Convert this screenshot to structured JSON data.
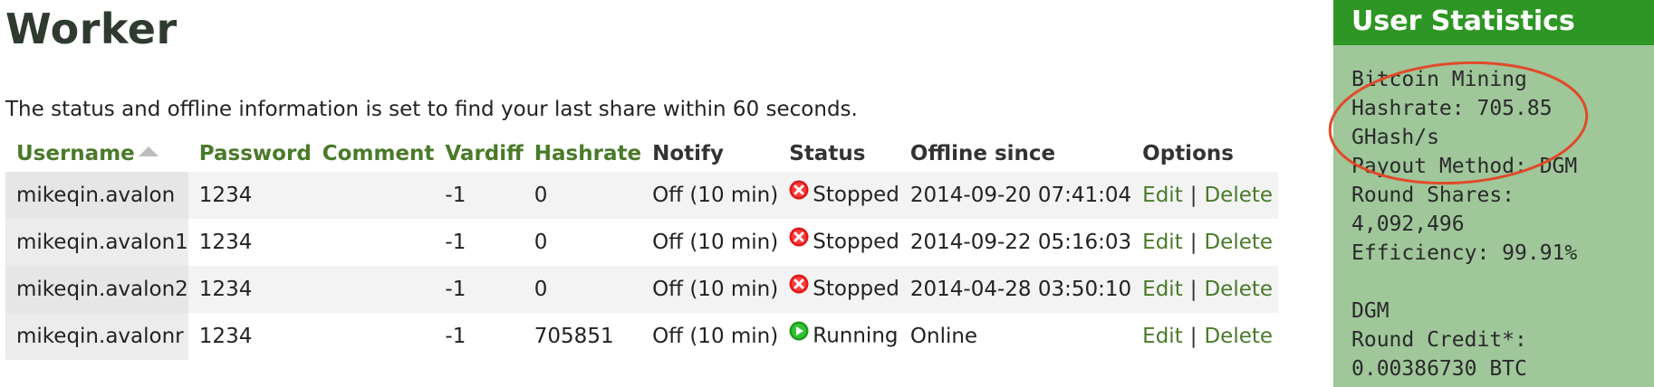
{
  "page": {
    "title": "Worker",
    "info": "The status and offline information is set to find your last share within 60 seconds."
  },
  "table": {
    "headers": {
      "username": "Username",
      "password": "Password",
      "comment": "Comment",
      "vardiff": "Vardiff",
      "hashrate": "Hashrate",
      "notify": "Notify",
      "status": "Status",
      "offline": "Offline since",
      "options": "Options"
    },
    "rows": [
      {
        "username": "mikeqin.avalon",
        "password": "1234",
        "comment": "",
        "vardiff": "-1",
        "hashrate": "0",
        "notify": "Off (10 min)",
        "status": "Stopped",
        "offline": "2014-09-20 07:41:04",
        "edit": "Edit",
        "delete": "Delete"
      },
      {
        "username": "mikeqin.avalon1",
        "password": "1234",
        "comment": "",
        "vardiff": "-1",
        "hashrate": "0",
        "notify": "Off (10 min)",
        "status": "Stopped",
        "offline": "2014-09-22 05:16:03",
        "edit": "Edit",
        "delete": "Delete"
      },
      {
        "username": "mikeqin.avalon2",
        "password": "1234",
        "comment": "",
        "vardiff": "-1",
        "hashrate": "0",
        "notify": "Off (10 min)",
        "status": "Stopped",
        "offline": "2014-04-28 03:50:10",
        "edit": "Edit",
        "delete": "Delete"
      },
      {
        "username": "mikeqin.avalonr",
        "password": "1234",
        "comment": "",
        "vardiff": "-1",
        "hashrate": "705851",
        "notify": "Off (10 min)",
        "status": "Running",
        "offline": "Online",
        "edit": "Edit",
        "delete": "Delete"
      }
    ],
    "separator": "|"
  },
  "sidebar": {
    "title": "User Statistics",
    "lines": [
      "Bitcoin Mining",
      "Hashrate: 705.85",
      "GHash/s",
      "Payout Method: DGM",
      "Round Shares:",
      "4,092,496",
      "Efficiency: 99.91%",
      "",
      "DGM",
      "Round Credit*:",
      "0.00386730 BTC"
    ]
  },
  "colors": {
    "link_green": "#4a7a2a",
    "sidebar_header": "#2e9624",
    "sidebar_bg": "#9fc79a",
    "offline_red": "#e02020",
    "online_green": "#2a8a1a",
    "annotation": "#e04a2a"
  },
  "icons": {
    "stopped": "stopped-x-icon",
    "running": "running-play-icon",
    "sort": "sort-asc-icon"
  }
}
